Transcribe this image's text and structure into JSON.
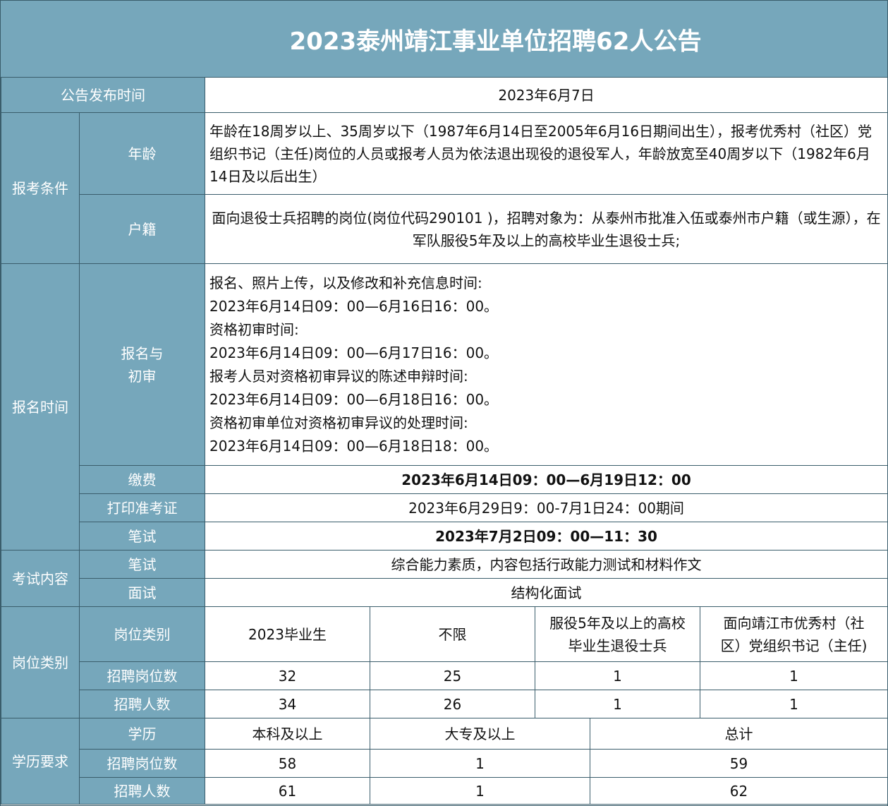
{
  "title": "2023泰州靖江事业单位招聘62人公告",
  "publish": {
    "label": "公告发布时间",
    "value": "2023年6月7日"
  },
  "conditions": {
    "label": "报考条件",
    "age": {
      "label": "年龄",
      "value": "年龄在18周岁以上、35周岁以下（1987年6月14日至2005年6月16日期间出生），报考优秀村（社区）党组织书记（主任)岗位的人员或报考人员为依法退出现役的退役军人，年龄放宽至40周岁以下（1982年6月14日及以后出生）"
    },
    "residence": {
      "label": "户籍",
      "value": "面向退役士兵招聘的岗位(岗位代码290101 )，招聘对象为：从泰州市批准入伍或泰州市户籍（或生源），在军队服役5年及以上的高校毕业生退役士兵;"
    }
  },
  "registration": {
    "label": "报名时间",
    "signup": {
      "label_line1": "报名与",
      "label_line2": "初审",
      "lines": [
        "报名、照片上传，以及修改和补充信息时间:",
        "2023年6月14日09：00—6月16日16：00。",
        "资格初审时间:",
        "2023年6月14日09：00—6月17日16：00。",
        "报考人员对资格初审异议的陈述申辩时间:",
        "2023年6月14日09：00—6月18日16：00。",
        "资格初审单位对资格初审异议的处理时间:",
        "2023年6月14日09：00—6月18日18：00。"
      ]
    },
    "fee": {
      "label": "缴费",
      "value": "2023年6月14日09：00—6月19日12：00"
    },
    "admit": {
      "label": "打印准考证",
      "value": "2023年6月29日9：00-7月1日24：00期间"
    },
    "written": {
      "label": "笔试",
      "value": "2023年7月2日09：00—11：30"
    }
  },
  "exam_content": {
    "label": "考试内容",
    "written": {
      "label": "笔试",
      "value": "综合能力素质，内容包括行政能力测试和材料作文"
    },
    "interview": {
      "label": "面试",
      "value": "结构化面试"
    }
  },
  "positions": {
    "label": "岗位类别",
    "header_label": "岗位类别",
    "categories": [
      {
        "line1": "2023毕业生",
        "line2": ""
      },
      {
        "line1": "不限",
        "line2": ""
      },
      {
        "line1": "服役5年及以上的高校",
        "line2": "毕业生退役士兵"
      },
      {
        "line1": "面向靖江市优秀村（社",
        "line2": "区）党组织书记（主任)"
      }
    ],
    "posts_label": "招聘岗位数",
    "posts": [
      "32",
      "25",
      "1",
      "1"
    ],
    "people_label": "招聘人数",
    "people": [
      "34",
      "26",
      "1",
      "1"
    ]
  },
  "education": {
    "label": "学历要求",
    "header_label": "学历",
    "levels": [
      "本科及以上",
      "大专及以上",
      "总计"
    ],
    "posts_label": "招聘岗位数",
    "posts": [
      "58",
      "1",
      "59"
    ],
    "people_label": "招聘人数",
    "people": [
      "61",
      "1",
      "62"
    ]
  },
  "colors": {
    "header_bg": "#76a7bb",
    "header_text": "#ffffff",
    "border": "#3a5d6b"
  }
}
